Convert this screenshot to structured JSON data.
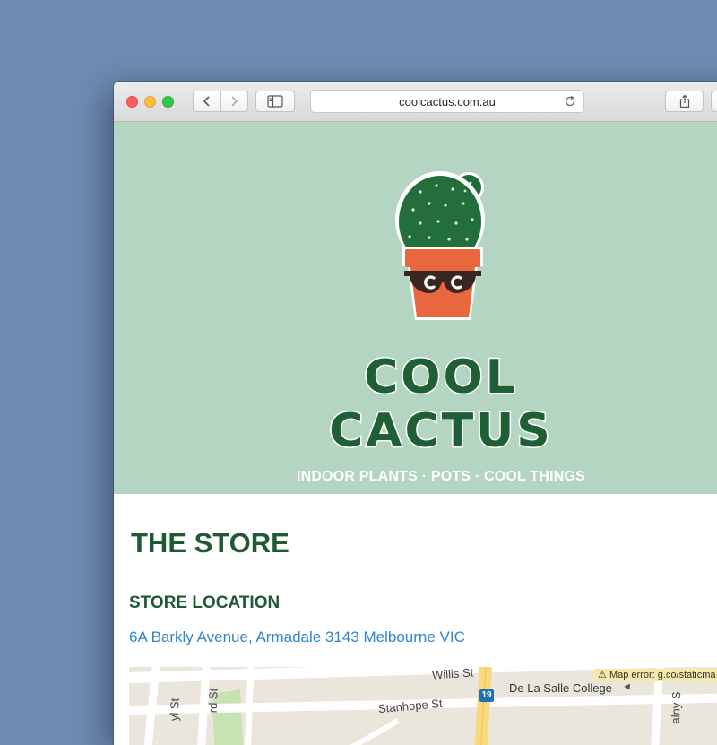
{
  "browser": {
    "url": "coolcactus.com.au"
  },
  "hero": {
    "brand": "COOL CACTUS",
    "tagline": "INDOOR PLANTS · POTS · COOL THINGS"
  },
  "content": {
    "store_title": "THE STORE",
    "location_heading": "STORE LOCATION",
    "address": "6A Barkly Avenue, Armadale 3143 Melbourne VIC"
  },
  "map": {
    "error": "Map error: g.co/staticma",
    "streets": {
      "willis": "Willis St",
      "stanhope": "Stanhope St",
      "street_a": "yl St",
      "street_b": "rd St",
      "street_c": "alny S"
    },
    "place": "De La Salle College",
    "route_number": "19"
  },
  "colors": {
    "desktop": "#6f8cb2",
    "hero_bg": "#b3d5c2",
    "brand_green": "#1f5a34",
    "link_blue": "#2f86c9",
    "pot_orange": "#e9673f"
  }
}
